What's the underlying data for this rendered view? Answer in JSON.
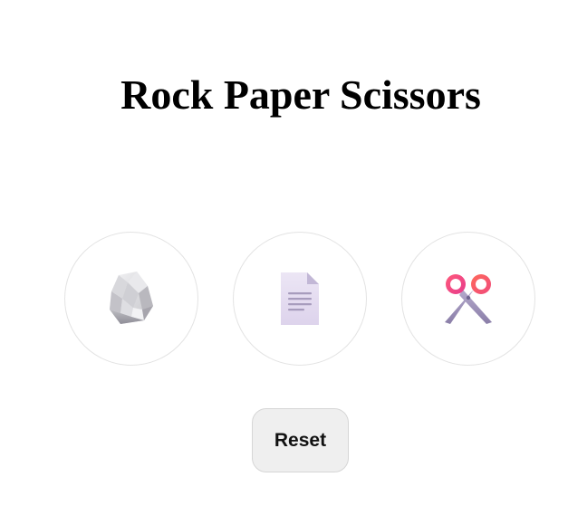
{
  "game": {
    "title": "Rock Paper Scissors"
  },
  "choices": [
    {
      "id": "rock",
      "icon": "rock-icon"
    },
    {
      "id": "paper",
      "icon": "paper-icon"
    },
    {
      "id": "scissors",
      "icon": "scissors-icon"
    }
  ],
  "controls": {
    "reset_label": "Reset"
  },
  "colors": {
    "background": "#ffffff",
    "choice_border": "#e3e3e3",
    "reset_background": "#efefef",
    "scissors_handle": "#f2456b",
    "scissors_blade": "#9b8fb6",
    "paper_fill": "#e7e0f2",
    "rock_fill": "#c9c9cc"
  }
}
